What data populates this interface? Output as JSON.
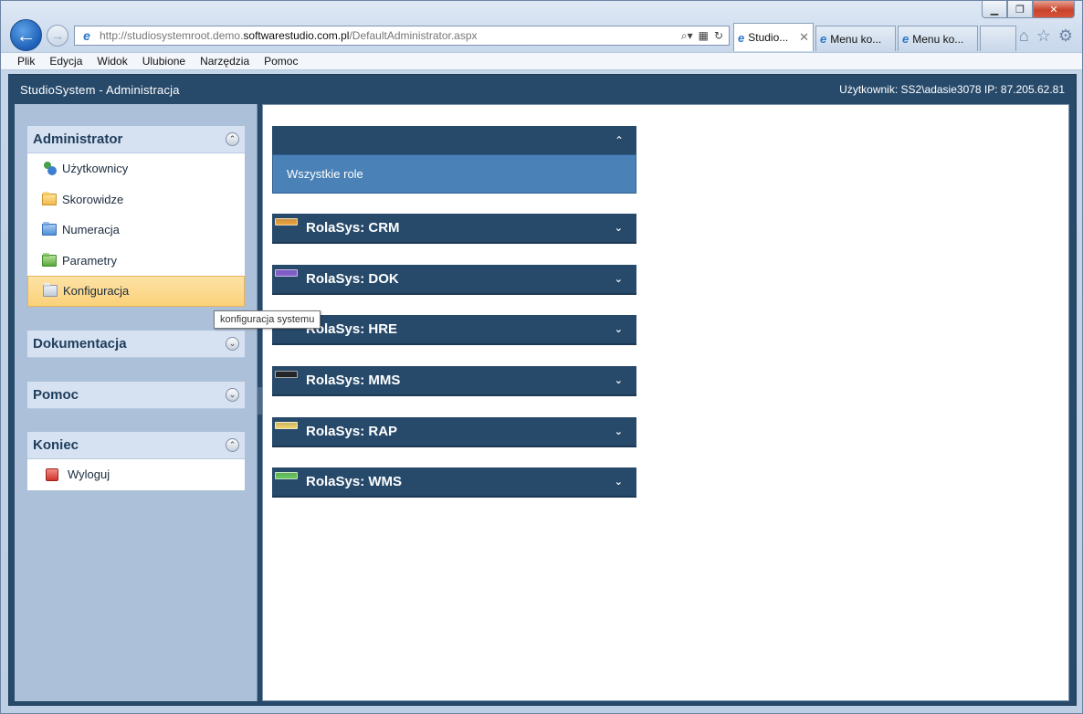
{
  "browser": {
    "address_prefix": "http://studiosystemroot.demo.",
    "address_domain": "softwarestudio.com.pl",
    "address_suffix": "/DefaultAdministrator.aspx",
    "tabs": [
      {
        "label": "Studio...",
        "active": true
      },
      {
        "label": "Menu ko...",
        "active": false
      },
      {
        "label": "Menu ko...",
        "active": false
      }
    ],
    "menu": [
      "Plik",
      "Edycja",
      "Widok",
      "Ulubione",
      "Narzędzia",
      "Pomoc"
    ]
  },
  "app": {
    "title": "StudioSystem - Administracja",
    "user_info": "Użytkownik: SS2\\adasie3078 IP: 87.205.62.81"
  },
  "sidebar": {
    "administrator": {
      "title": "Administrator",
      "items": [
        {
          "label": "Użytkownicy",
          "icon": "users-icon"
        },
        {
          "label": "Skorowidze",
          "icon": "folder-yellow-icon"
        },
        {
          "label": "Numeracja",
          "icon": "folder-blue-icon"
        },
        {
          "label": "Parametry",
          "icon": "folder-green-icon"
        },
        {
          "label": "Konfiguracja",
          "icon": "folder-gray-icon",
          "selected": true
        }
      ]
    },
    "dokumentacja": {
      "title": "Dokumentacja"
    },
    "pomoc": {
      "title": "Pomoc"
    },
    "koniec": {
      "title": "Koniec",
      "items": [
        {
          "label": "Wyloguj",
          "icon": "logout-icon"
        }
      ]
    }
  },
  "tooltip": "konfiguracja systemu",
  "roles": {
    "all_label": "Wszystkie role",
    "list": [
      {
        "label": "RolaSys: CRM",
        "color": "#f0a43a"
      },
      {
        "label": "RolaSys: DOK",
        "color": "#8a5fd0"
      },
      {
        "label": "RolaSys: HRE",
        "color": "#3a6fa8"
      },
      {
        "label": "RolaSys: MMS",
        "color": "#222222"
      },
      {
        "label": "RolaSys: RAP",
        "color": "#f3d26a"
      },
      {
        "label": "RolaSys: WMS",
        "color": "#6cc95a"
      }
    ]
  }
}
